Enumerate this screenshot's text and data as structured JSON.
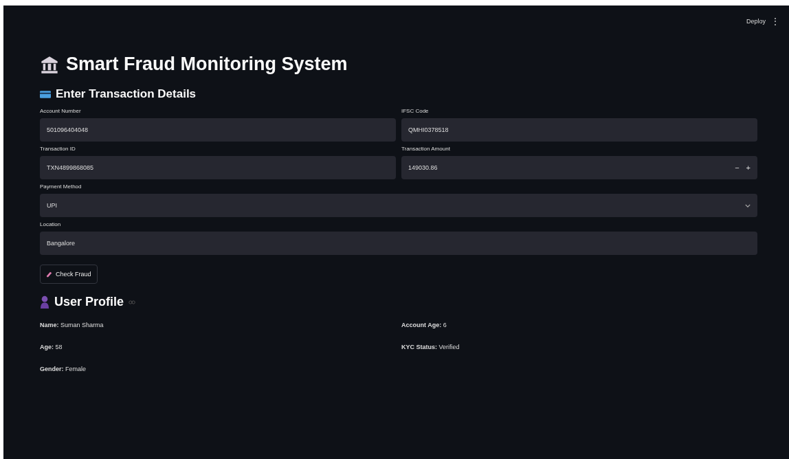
{
  "header": {
    "deploy_label": "Deploy",
    "menu_glyph": "⋮"
  },
  "title": "Smart Fraud Monitoring System",
  "form_heading": "Enter Transaction Details",
  "fields": [
    {
      "kind": "text",
      "label": "Account Number",
      "value": "501096404048"
    },
    {
      "kind": "text",
      "label": "IFSC Code",
      "value": "QMHI0378518"
    },
    {
      "kind": "text",
      "label": "Transaction ID",
      "value": "TXN4899868085"
    },
    {
      "kind": "number",
      "label": "Transaction Amount",
      "value": "149030.86",
      "minus": "−",
      "plus": "+"
    },
    {
      "kind": "select",
      "label": "Payment Method",
      "value": "UPI"
    },
    {
      "kind": "text",
      "label": "Location",
      "value": "Bangalore"
    }
  ],
  "check_button": "Check Fraud",
  "profile_heading": "User Profile",
  "profile": [
    {
      "text": "**Name:** Suman Sharma"
    },
    {
      "text": "**Account Age:** 6"
    },
    {
      "text": "**Age:** 58"
    },
    {
      "text": "**KYC Status:** Verified"
    },
    {
      "text": "**Gender:** Female"
    }
  ]
}
